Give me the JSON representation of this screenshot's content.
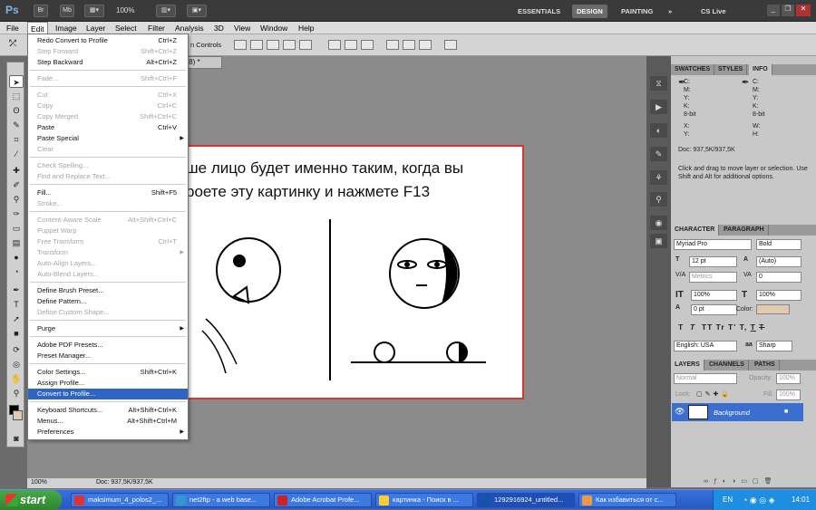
{
  "app": {
    "logo": "Ps",
    "bridge": "Br",
    "minibridge": "Mb",
    "zoom": "100%",
    "workspaces": [
      "ESSENTIALS",
      "DESIGN",
      "PAINTING"
    ],
    "more": "»",
    "cslive": "CS Live"
  },
  "menubar": [
    "File",
    "Edit",
    "Image",
    "Layer",
    "Select",
    "Filter",
    "Analysis",
    "3D",
    "View",
    "Window",
    "Help"
  ],
  "options": {
    "controls": "n Controls"
  },
  "document": {
    "tab_label": "/8) *",
    "text_line1": "ше лицо будет именно таким, когда вы",
    "text_line2": "роете эту картинку и нажмете F13"
  },
  "status": {
    "zoom": "100%",
    "doc": "Doc: 937,5K/937,5K"
  },
  "edit_menu": [
    {
      "label": "Redo Convert to Profile",
      "shortcut": "Ctrl+Z",
      "enabled": true
    },
    {
      "label": "Step Forward",
      "shortcut": "Shift+Ctrl+Z",
      "enabled": false
    },
    {
      "label": "Step Backward",
      "shortcut": "Alt+Ctrl+Z",
      "enabled": true
    },
    {
      "sep": true
    },
    {
      "label": "Fade...",
      "shortcut": "Shift+Ctrl+F",
      "enabled": false
    },
    {
      "sep": true
    },
    {
      "label": "Cut",
      "shortcut": "Ctrl+X",
      "enabled": false
    },
    {
      "label": "Copy",
      "shortcut": "Ctrl+C",
      "enabled": false
    },
    {
      "label": "Copy Merged",
      "shortcut": "Shift+Ctrl+C",
      "enabled": false
    },
    {
      "label": "Paste",
      "shortcut": "Ctrl+V",
      "enabled": true
    },
    {
      "label": "Paste Special",
      "shortcut": "",
      "enabled": true,
      "submenu": true
    },
    {
      "label": "Clear",
      "shortcut": "",
      "enabled": false
    },
    {
      "sep": true
    },
    {
      "label": "Check Spelling...",
      "shortcut": "",
      "enabled": false
    },
    {
      "label": "Find and Replace Text...",
      "shortcut": "",
      "enabled": false
    },
    {
      "sep": true
    },
    {
      "label": "Fill...",
      "shortcut": "Shift+F5",
      "enabled": true
    },
    {
      "label": "Stroke...",
      "shortcut": "",
      "enabled": false
    },
    {
      "sep": true
    },
    {
      "label": "Content-Aware Scale",
      "shortcut": "Alt+Shift+Ctrl+C",
      "enabled": false
    },
    {
      "label": "Puppet Warp",
      "shortcut": "",
      "enabled": false
    },
    {
      "label": "Free Transform",
      "shortcut": "Ctrl+T",
      "enabled": false
    },
    {
      "label": "Transform",
      "shortcut": "",
      "enabled": false,
      "submenu": true
    },
    {
      "label": "Auto-Align Layers...",
      "shortcut": "",
      "enabled": false
    },
    {
      "label": "Auto-Blend Layers...",
      "shortcut": "",
      "enabled": false
    },
    {
      "sep": true
    },
    {
      "label": "Define Brush Preset...",
      "shortcut": "",
      "enabled": true
    },
    {
      "label": "Define Pattern...",
      "shortcut": "",
      "enabled": true
    },
    {
      "label": "Define Custom Shape...",
      "shortcut": "",
      "enabled": false
    },
    {
      "sep": true
    },
    {
      "label": "Purge",
      "shortcut": "",
      "enabled": true,
      "submenu": true
    },
    {
      "sep": true
    },
    {
      "label": "Adobe PDF Presets...",
      "shortcut": "",
      "enabled": true
    },
    {
      "label": "Preset Manager...",
      "shortcut": "",
      "enabled": true
    },
    {
      "sep": true
    },
    {
      "label": "Color Settings...",
      "shortcut": "Shift+Ctrl+K",
      "enabled": true
    },
    {
      "label": "Assign Profile...",
      "shortcut": "",
      "enabled": true
    },
    {
      "label": "Convert to Profile...",
      "shortcut": "",
      "enabled": true,
      "selected": true
    },
    {
      "sep": true
    },
    {
      "label": "Keyboard Shortcuts...",
      "shortcut": "Alt+Shift+Ctrl+K",
      "enabled": true
    },
    {
      "label": "Menus...",
      "shortcut": "Alt+Shift+Ctrl+M",
      "enabled": true
    },
    {
      "label": "Preferences",
      "shortcut": "",
      "enabled": true,
      "submenu": true
    }
  ],
  "info_panel": {
    "tabs": [
      "SWATCHES",
      "STYLES",
      "INFO"
    ],
    "c": "C:",
    "m": "M:",
    "y": "Y:",
    "k": "K:",
    "bit": "8-bit",
    "x": "X:",
    "yy": "Y:",
    "w": "W:",
    "h": "H:",
    "doc": "Doc: 937,5K/937,5K",
    "hint": "Click and drag to move layer or selection. Use Shift and Alt for additional options."
  },
  "character_panel": {
    "tabs": [
      "CHARACTER",
      "PARAGRAPH"
    ],
    "font": "Myriad Pro",
    "style": "Bold",
    "size": "12 pt",
    "leading": "(Auto)",
    "kerning": "Metrics",
    "tracking": "0",
    "vscale": "100%",
    "hscale": "100%",
    "baseline": "0 pt",
    "color_label": "Color:",
    "styles": [
      "T",
      "T",
      "TT",
      "Tr",
      "T'",
      "T,",
      "T",
      "T"
    ],
    "language": "English: USA",
    "aa_label": "aa",
    "antialias": "Sharp"
  },
  "layers_panel": {
    "tabs": [
      "LAYERS",
      "CHANNELS",
      "PATHS"
    ],
    "blend": "Normal",
    "opacity_label": "Opacity:",
    "opacity": "100%",
    "lock_label": "Lock:",
    "fill_label": "Fill:",
    "fill": "100%",
    "layer_name": "Background"
  },
  "taskbar": {
    "start": "start",
    "tasks": [
      "maksimum_4_polos2_...",
      "net2ftp - a web base...",
      "Adobe Acrobat Profe...",
      "картинка - Поиск в ...",
      "1292916924_untitled...",
      "Как избавиться от с..."
    ],
    "lang": "EN",
    "clock": "14:01"
  },
  "colors": {
    "selected": "#2f63c4",
    "canvas_border": "#dd3333",
    "swatch": "#e0cbb0"
  }
}
